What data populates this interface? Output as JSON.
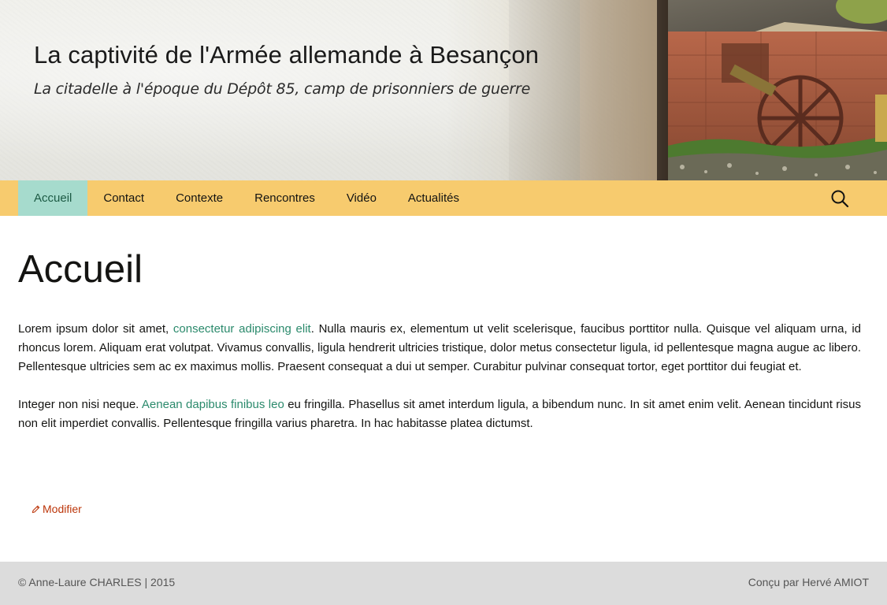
{
  "header": {
    "title": "La captivité de l'Armée allemande à Besançon",
    "description": "La citadelle à l'époque du Dépôt 85, camp de prisonniers de guerre"
  },
  "nav": {
    "items": [
      {
        "label": "Accueil",
        "active": true
      },
      {
        "label": "Contact",
        "active": false
      },
      {
        "label": "Contexte",
        "active": false
      },
      {
        "label": "Rencontres",
        "active": false
      },
      {
        "label": "Vidéo",
        "active": false
      },
      {
        "label": "Actualités",
        "active": false
      }
    ],
    "search_icon": "search-icon",
    "bar_color": "#f7cb6e",
    "active_color": "#a6dbcd"
  },
  "page": {
    "title": "Accueil",
    "paragraph1": {
      "before": "Lorem ipsum dolor sit amet, ",
      "link": "consectetur adipiscing elit",
      "after": ". Nulla mauris ex, elementum ut velit scelerisque, faucibus porttitor nulla. Quisque vel aliquam urna, id rhoncus lorem. Aliquam erat volutpat. Vivamus convallis, ligula hendrerit ultricies tristique, dolor metus consectetur ligula, id pellentesque magna augue ac libero. Pellentesque ultricies sem ac ex maximus mollis. Praesent consequat a dui ut semper. Curabitur pulvinar consequat tortor, eget porttitor dui feugiat et."
    },
    "paragraph2": {
      "before": "Integer non nisi neque. ",
      "link": "Aenean dapibus finibus leo",
      "after": " eu fringilla. Phasellus sit amet interdum ligula, a bibendum nunc. In sit amet enim velit. Aenean tincidunt risus non elit imperdiet convallis. Pellentesque fringilla varius pharetra. In hac habitasse platea dictumst."
    },
    "edit_label": "Modifier",
    "edit_icon": "pencil-icon",
    "link_color": "#2b8a6c",
    "edit_color": "#bc360a"
  },
  "footer": {
    "copyright": "© Anne-Laure CHARLES | 2015",
    "credit": "Conçu par Hervé AMIOT"
  }
}
